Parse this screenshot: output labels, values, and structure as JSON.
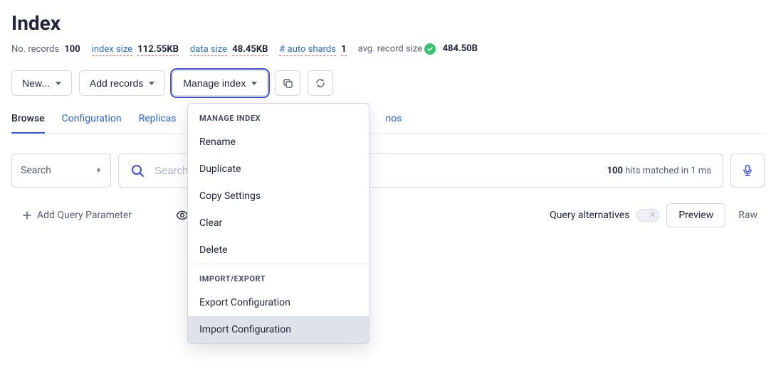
{
  "page_title": "Index",
  "stats": {
    "no_records_label": "No. records",
    "no_records_value": "100",
    "index_size_label": "index size",
    "index_size_value": "112.55KB",
    "data_size_label": "data size",
    "data_size_value": "48.45KB",
    "auto_shards_label": "# auto shards",
    "auto_shards_value": "1",
    "avg_record_label": "avg. record size",
    "avg_record_value": "484.50B"
  },
  "toolbar": {
    "new_label": "New...",
    "add_records_label": "Add records",
    "manage_index_label": "Manage index"
  },
  "tabs": {
    "browse": "Browse",
    "configuration": "Configuration",
    "replicas": "Replicas",
    "demos": "nos"
  },
  "search": {
    "mode_label": "Search",
    "placeholder": "Search",
    "value": "",
    "hits_count": "100",
    "hits_suffix": " hits matched in 1 ms"
  },
  "query": {
    "add_param_label": "Add Query Parameter",
    "alternatives_label": "Query alternatives",
    "preview_label": "Preview",
    "raw_label": "Raw"
  },
  "dropdown": {
    "header1": "MANAGE INDEX",
    "rename": "Rename",
    "duplicate": "Duplicate",
    "copy_settings": "Copy Settings",
    "clear": "Clear",
    "delete": "Delete",
    "header2": "IMPORT/EXPORT",
    "export_config": "Export Configuration",
    "import_config": "Import Configuration"
  }
}
